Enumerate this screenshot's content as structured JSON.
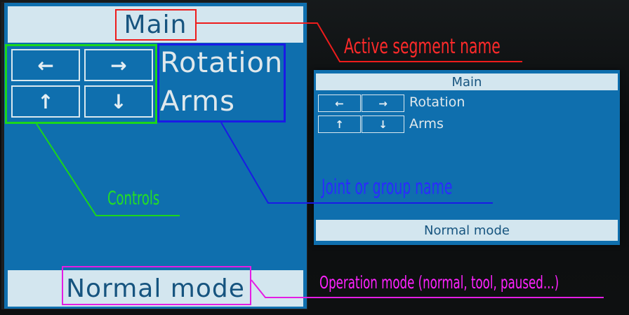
{
  "large_screen": {
    "header": "Main",
    "keys": [
      "←",
      "→",
      "↑",
      "↓"
    ],
    "labels": [
      "Rotation",
      "Arms"
    ],
    "footer": "Normal mode"
  },
  "small_screen": {
    "header": "Main",
    "keys": [
      "←",
      "→",
      "↑",
      "↓"
    ],
    "labels": [
      "Rotation",
      "Arms"
    ],
    "footer": "Normal mode"
  },
  "callouts": {
    "active_segment": "Active segment name",
    "controls": "Controls",
    "joint_group": "Joint or group name",
    "operation_mode": "Operation mode (normal, tool, paused...)"
  },
  "colors": {
    "screen_blue": "#0f6fae",
    "bar_light": "#d3e6ef",
    "text_dark_blue": "#16547f",
    "red": "#ee1c1c",
    "green": "#1bd61b",
    "blue": "#1a1ae6",
    "magenta": "#e41de4"
  }
}
